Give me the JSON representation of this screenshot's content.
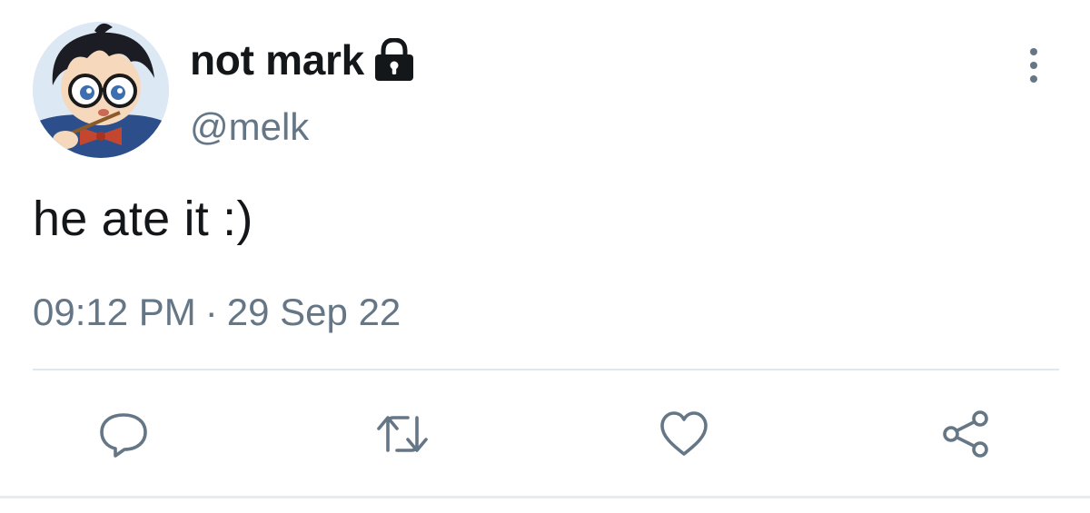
{
  "tweet": {
    "display_name": "not mark",
    "handle": "@melk",
    "text": "he ate it :)",
    "time": "09:12 PM",
    "separator": "·",
    "date": "29 Sep 22",
    "protected_icon": "lock-icon",
    "menu_icon": "more-vertical-icon"
  },
  "actions": [
    {
      "name": "reply",
      "icon": "reply-icon"
    },
    {
      "name": "retweet",
      "icon": "retweet-icon"
    },
    {
      "name": "like",
      "icon": "heart-icon"
    },
    {
      "name": "share",
      "icon": "share-icon"
    }
  ],
  "colors": {
    "text_primary": "#14171a",
    "text_secondary": "#657786",
    "icon": "#657786",
    "divider": "#e1e8ed",
    "background": "#ffffff"
  }
}
